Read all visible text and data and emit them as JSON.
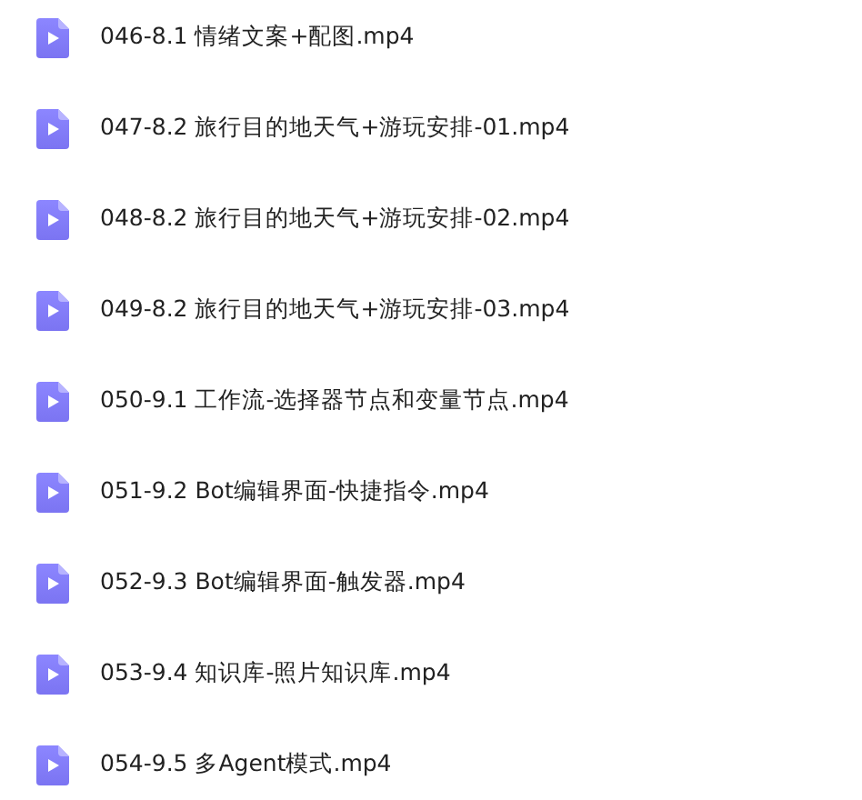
{
  "files": [
    {
      "name": "046-8.1 情绪文案+配图.mp4"
    },
    {
      "name": "047-8.2 旅行目的地天气+游玩安排-01.mp4"
    },
    {
      "name": "048-8.2 旅行目的地天气+游玩安排-02.mp4"
    },
    {
      "name": "049-8.2 旅行目的地天气+游玩安排-03.mp4"
    },
    {
      "name": "050-9.1 工作流-选择器节点和变量节点.mp4"
    },
    {
      "name": "051-9.2 Bot编辑界面-快捷指令.mp4"
    },
    {
      "name": "052-9.3 Bot编辑界面-触发器.mp4"
    },
    {
      "name": "053-9.4 知识库-照片知识库.mp4"
    },
    {
      "name": "054-9.5 多Agent模式.mp4"
    }
  ]
}
